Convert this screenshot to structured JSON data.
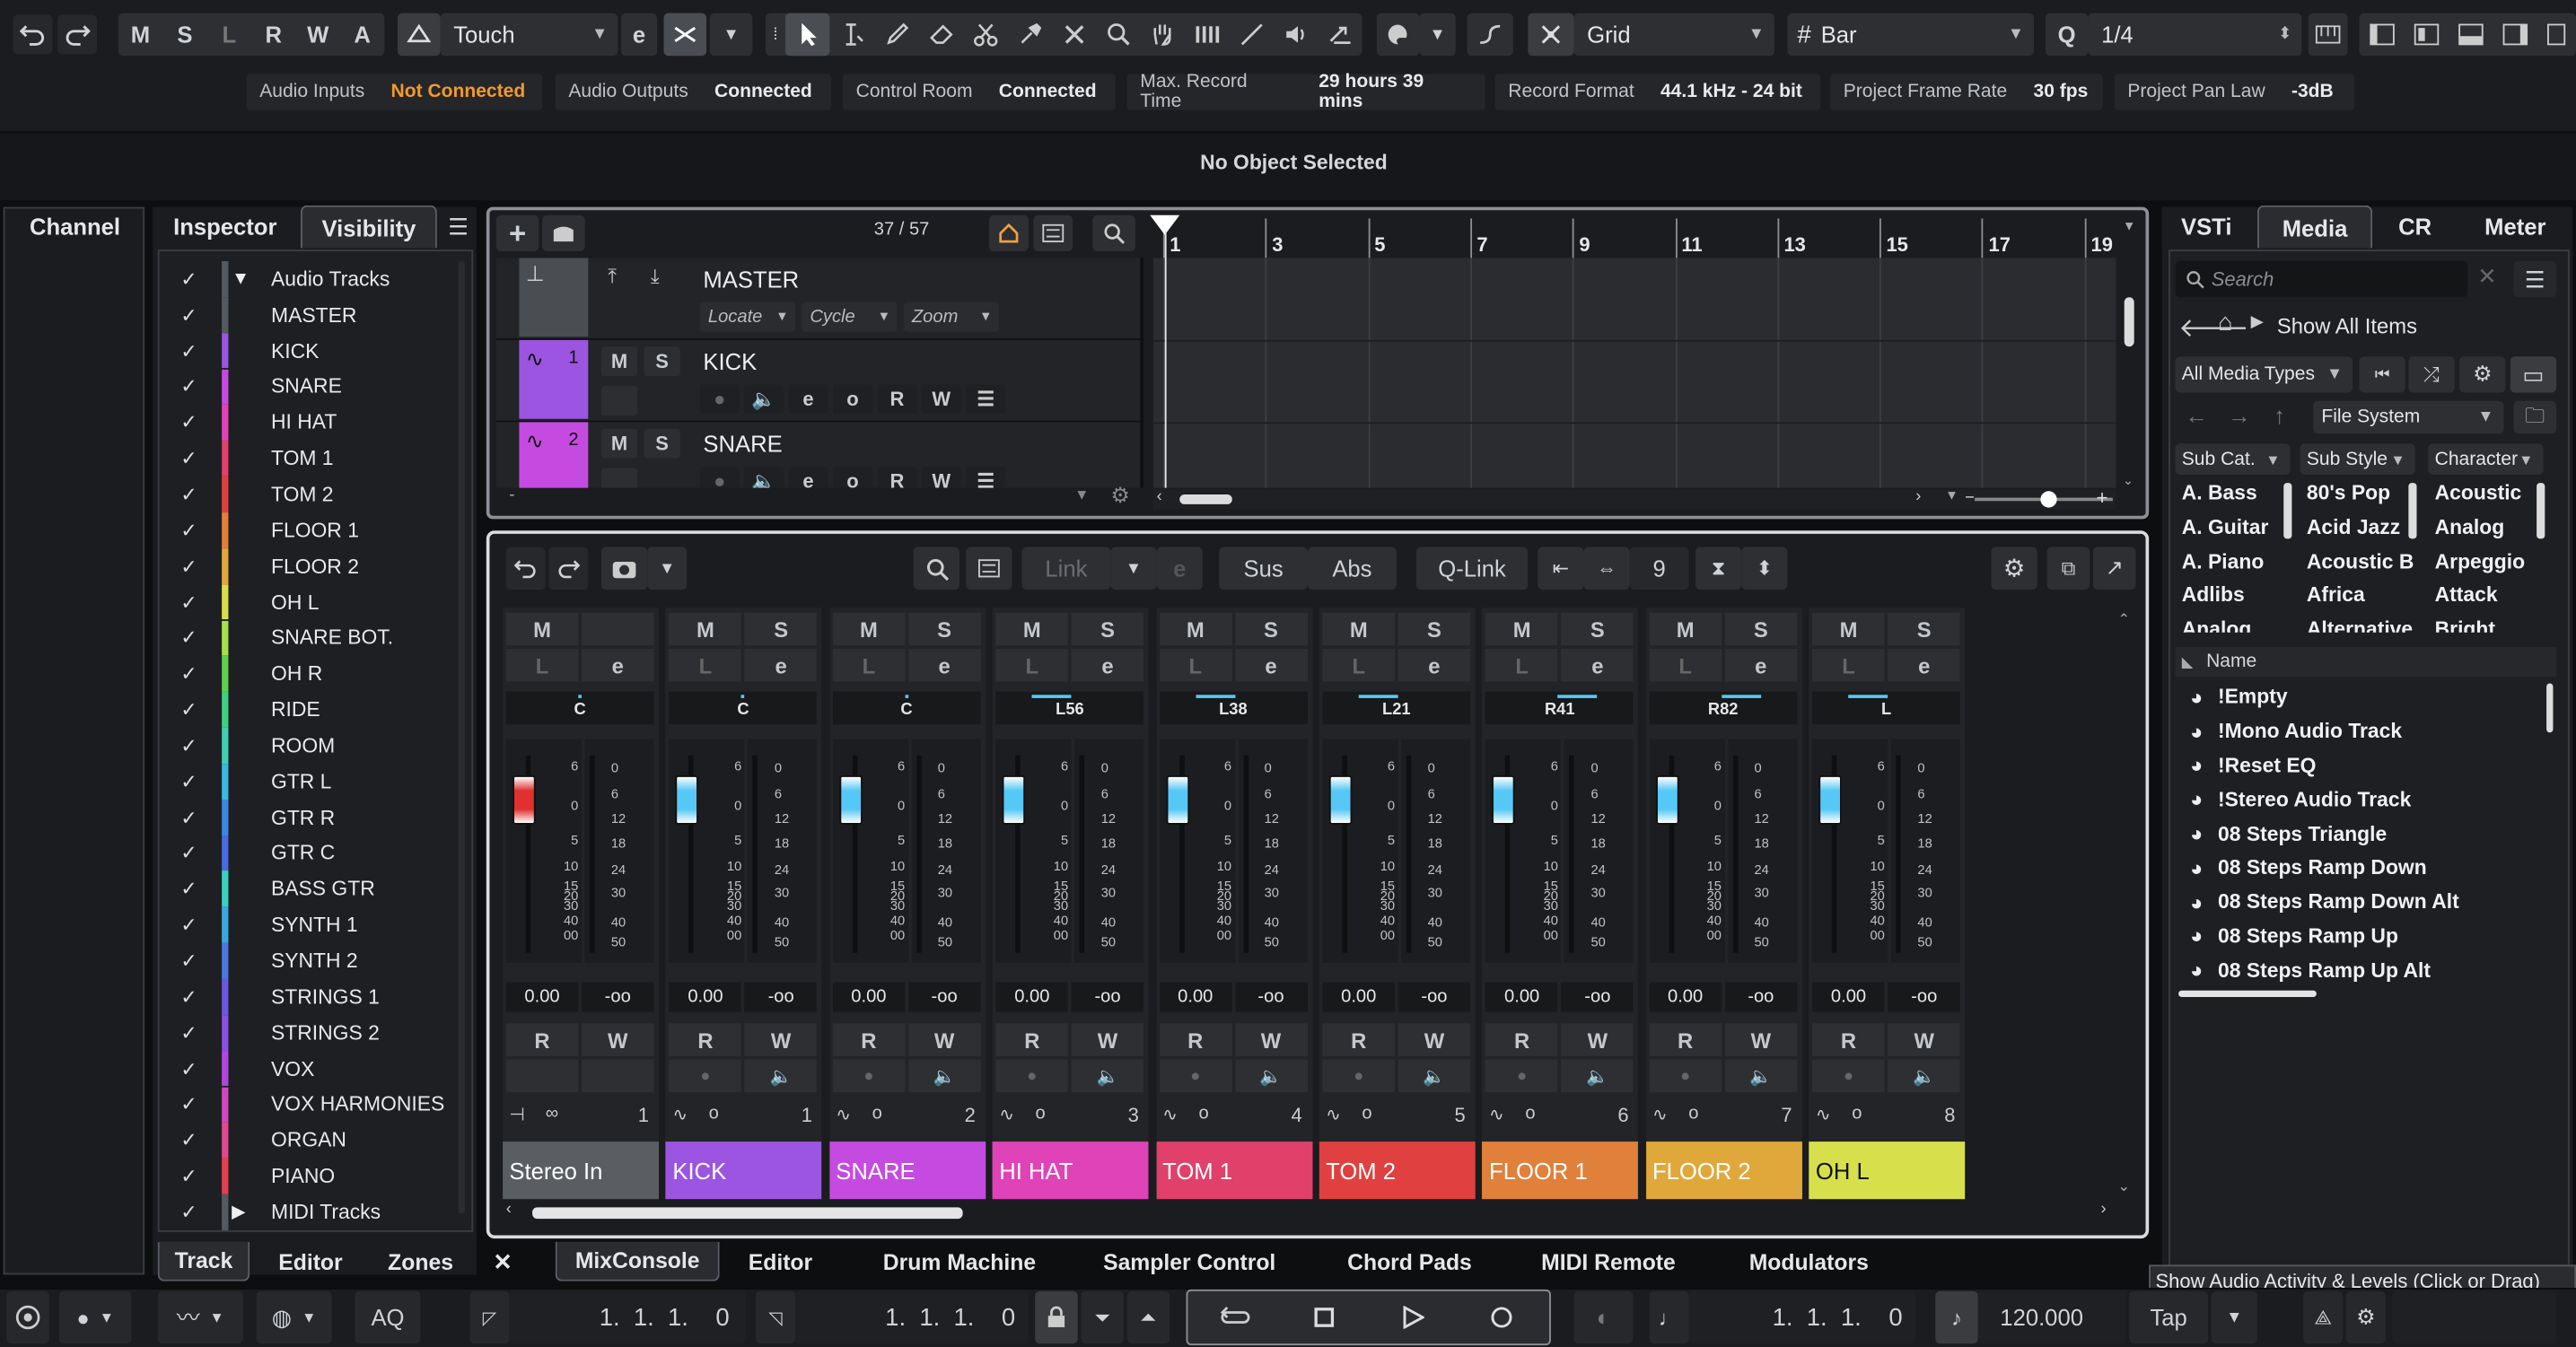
{
  "toolbar": {
    "mode_buttons": [
      "M",
      "S",
      "L",
      "R",
      "W",
      "A"
    ],
    "automation_mode": "Touch",
    "grid_type": "Grid",
    "grid_value": "Bar",
    "quantize_value": "1/4"
  },
  "status": [
    {
      "label": "Audio Inputs",
      "value": "Not Connected",
      "color": "#f29a2b"
    },
    {
      "label": "Audio Outputs",
      "value": "Connected",
      "color": "#e9eaec"
    },
    {
      "label": "Control Room",
      "value": "Connected",
      "color": "#e9eaec"
    },
    {
      "label": "Max. Record Time",
      "value": "29 hours 39 mins",
      "color": "#e9eaec"
    },
    {
      "label": "Record Format",
      "value": "44.1 kHz - 24 bit",
      "color": "#e9eaec"
    },
    {
      "label": "Project Frame Rate",
      "value": "30 fps",
      "color": "#e9eaec"
    },
    {
      "label": "Project Pan Law",
      "value": "-3dB",
      "color": "#e9eaec"
    }
  ],
  "info_line": "No Object Selected",
  "left_zone": {
    "channel_tab": "Channel",
    "tabs": [
      "Inspector",
      "Visibility"
    ],
    "selected_tab": "Visibility",
    "visibility_items": [
      {
        "label": "Audio Tracks",
        "color": "#555a60",
        "folder": true
      },
      {
        "label": "MASTER",
        "color": "#555a60"
      },
      {
        "label": "KICK",
        "color": "#9b55e0"
      },
      {
        "label": "SNARE",
        "color": "#c54be0"
      },
      {
        "label": "HI HAT",
        "color": "#e043b8"
      },
      {
        "label": "TOM 1",
        "color": "#e0406a"
      },
      {
        "label": "TOM 2",
        "color": "#e04040"
      },
      {
        "label": "FLOOR 1",
        "color": "#e0803a"
      },
      {
        "label": "FLOOR 2",
        "color": "#e0a83a"
      },
      {
        "label": "OH L",
        "color": "#d7e04a"
      },
      {
        "label": "SNARE BOT.",
        "color": "#a6e04a"
      },
      {
        "label": "OH R",
        "color": "#5ed04a"
      },
      {
        "label": "RIDE",
        "color": "#3ed080"
      },
      {
        "label": "ROOM",
        "color": "#3ed0b0"
      },
      {
        "label": "GTR L",
        "color": "#3ab8e0"
      },
      {
        "label": "GTR R",
        "color": "#3a88e0"
      },
      {
        "label": "GTR C",
        "color": "#4a6ae0"
      },
      {
        "label": "BASS GTR",
        "color": "#3ad0c0"
      },
      {
        "label": "SYNTH 1",
        "color": "#3aa8e0"
      },
      {
        "label": "SYNTH 2",
        "color": "#4a78e0"
      },
      {
        "label": "STRINGS 1",
        "color": "#6a58e0"
      },
      {
        "label": "STRINGS 2",
        "color": "#8a50e0"
      },
      {
        "label": "VOX",
        "color": "#b048e0"
      },
      {
        "label": "VOX HARMONIES",
        "color": "#d048c0"
      },
      {
        "label": "ORGAN",
        "color": "#e04890"
      },
      {
        "label": "PIANO",
        "color": "#e04050"
      },
      {
        "label": "MIDI Tracks",
        "color": "#555a60",
        "folder": true
      }
    ],
    "bottom_tabs": [
      "Track",
      "Editor",
      "Zones"
    ]
  },
  "project": {
    "track_count": "37 / 57",
    "tracks": [
      {
        "name": "MASTER",
        "num": "",
        "color": "#4a4d52",
        "sub": [
          "Locate",
          "Cycle",
          "Zoom"
        ]
      },
      {
        "name": "KICK",
        "num": "1",
        "color": "#9b55e0"
      },
      {
        "name": "SNARE",
        "num": "2",
        "color": "#c54be0"
      }
    ],
    "ruler": [
      "1",
      "3",
      "5",
      "7",
      "9",
      "11",
      "13",
      "15",
      "17",
      "19"
    ]
  },
  "mixer": {
    "link_label": "Link",
    "sus_label": "Sus",
    "abs_label": "Abs",
    "qlink_label": "Q-Link",
    "channel_count": "9",
    "fader_scale": [
      "6",
      "0",
      "5",
      "10",
      "15",
      "20",
      "30",
      "40",
      "00"
    ],
    "meter_scale": [
      "0",
      "6",
      "12",
      "18",
      "24",
      "30",
      "40",
      "50"
    ],
    "channels": [
      {
        "name": "Stereo In",
        "num": "1",
        "pan": "C",
        "color": "#5a5d62",
        "fader_color": "#e03030",
        "vol": "0.00",
        "peak": "-oo"
      },
      {
        "name": "KICK",
        "num": "1",
        "pan": "C",
        "color": "#9b55e0",
        "fader_color": "#56c8f5",
        "vol": "0.00",
        "peak": "-oo"
      },
      {
        "name": "SNARE",
        "num": "2",
        "pan": "C",
        "color": "#c54be0",
        "fader_color": "#56c8f5",
        "vol": "0.00",
        "peak": "-oo"
      },
      {
        "name": "HI HAT",
        "num": "3",
        "pan": "L56",
        "color": "#e043b8",
        "fader_color": "#56c8f5",
        "vol": "0.00",
        "peak": "-oo"
      },
      {
        "name": "TOM 1",
        "num": "4",
        "pan": "L38",
        "color": "#e0406a",
        "fader_color": "#56c8f5",
        "vol": "0.00",
        "peak": "-oo"
      },
      {
        "name": "TOM 2",
        "num": "5",
        "pan": "L21",
        "color": "#e04040",
        "fader_color": "#56c8f5",
        "vol": "0.00",
        "peak": "-oo"
      },
      {
        "name": "FLOOR 1",
        "num": "6",
        "pan": "R41",
        "color": "#e0803a",
        "fader_color": "#56c8f5",
        "vol": "0.00",
        "peak": "-oo"
      },
      {
        "name": "FLOOR 2",
        "num": "7",
        "pan": "R82",
        "color": "#e0a83a",
        "fader_color": "#56c8f5",
        "vol": "0.00",
        "peak": "-oo"
      },
      {
        "name": "OH L",
        "num": "8",
        "pan": "L",
        "color": "#d7e04a",
        "fader_color": "#56c8f5",
        "vol": "0.00",
        "peak": "-oo"
      }
    ]
  },
  "lower_tabs": [
    "MixConsole",
    "Editor",
    "Drum Machine",
    "Sampler Control",
    "Chord Pads",
    "MIDI Remote",
    "Modulators"
  ],
  "right_zone": {
    "tabs": [
      "VSTi",
      "Media",
      "CR",
      "Meter"
    ],
    "selected_tab": "Media",
    "search_placeholder": "Search",
    "show_all": "Show All Items",
    "media_types": "All Media Types",
    "file_system": "File System",
    "filters": [
      {
        "header": "Sub Cat.",
        "items": [
          "A. Bass",
          "A. Guitar",
          "A. Piano",
          "Adlibs",
          "Analog"
        ]
      },
      {
        "header": "Sub Style",
        "items": [
          "80's Pop",
          "Acid Jazz",
          "Acoustic B",
          "Africa",
          "Alternative"
        ]
      },
      {
        "header": "Character",
        "items": [
          "Acoustic",
          "Analog",
          "Arpeggio",
          "Attack",
          "Bright"
        ]
      }
    ],
    "results_header": "Name",
    "results": [
      "!Empty",
      "!Mono Audio Track",
      "!Reset EQ",
      "!Stereo Audio Track",
      "08 Steps  Triangle",
      "08 Steps Ramp Down",
      "08 Steps Ramp Down Alt",
      "08 Steps Ramp Up",
      "08 Steps Ramp Up Alt"
    ]
  },
  "tooltip": "Show Audio Activity & Levels (Click or Drag)",
  "transport": {
    "aq_label": "AQ",
    "left_locator": "1.  1.  1.    0",
    "right_locator": "1.  1.  1.    0",
    "position": "1.  1.  1.    0",
    "tempo": "120.000",
    "tap_label": "Tap"
  }
}
